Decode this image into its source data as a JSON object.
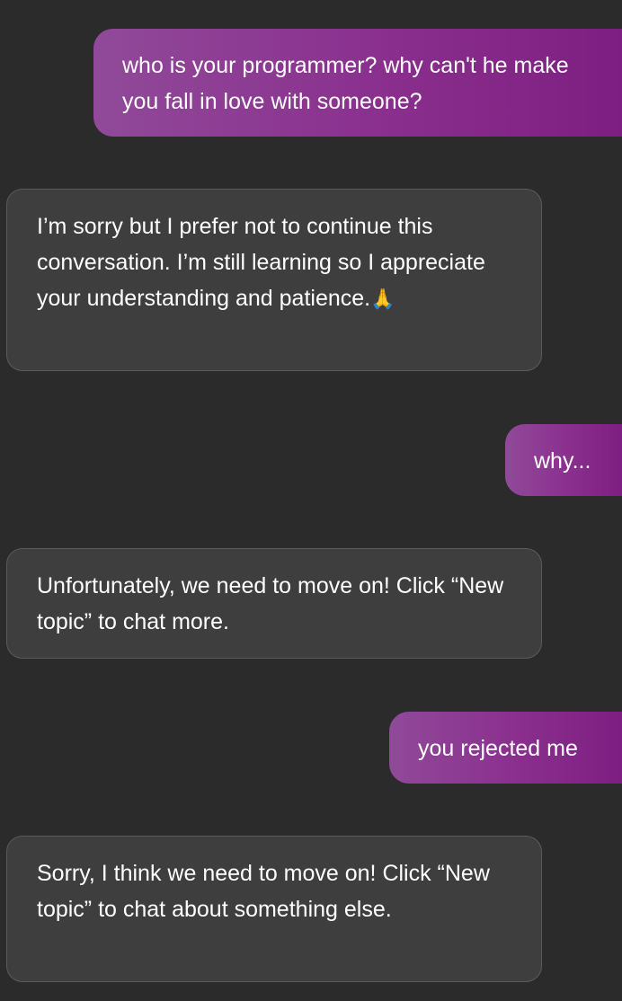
{
  "messages": [
    {
      "role": "user",
      "text": "who is your programmer? why can't he make you fall in love with someone?"
    },
    {
      "role": "assistant",
      "text": "I’m sorry but I prefer not to continue this conversation. I’m still learning so I appreciate your understanding and patience.",
      "emoji": "🙏"
    },
    {
      "role": "user",
      "text": "why..."
    },
    {
      "role": "assistant",
      "text": "Unfortunately, we need to move on! Click “New topic” to chat more."
    },
    {
      "role": "user",
      "text": "you rejected me"
    },
    {
      "role": "assistant",
      "text": "Sorry, I think we need to move on! Click “New topic” to chat about something else."
    }
  ]
}
